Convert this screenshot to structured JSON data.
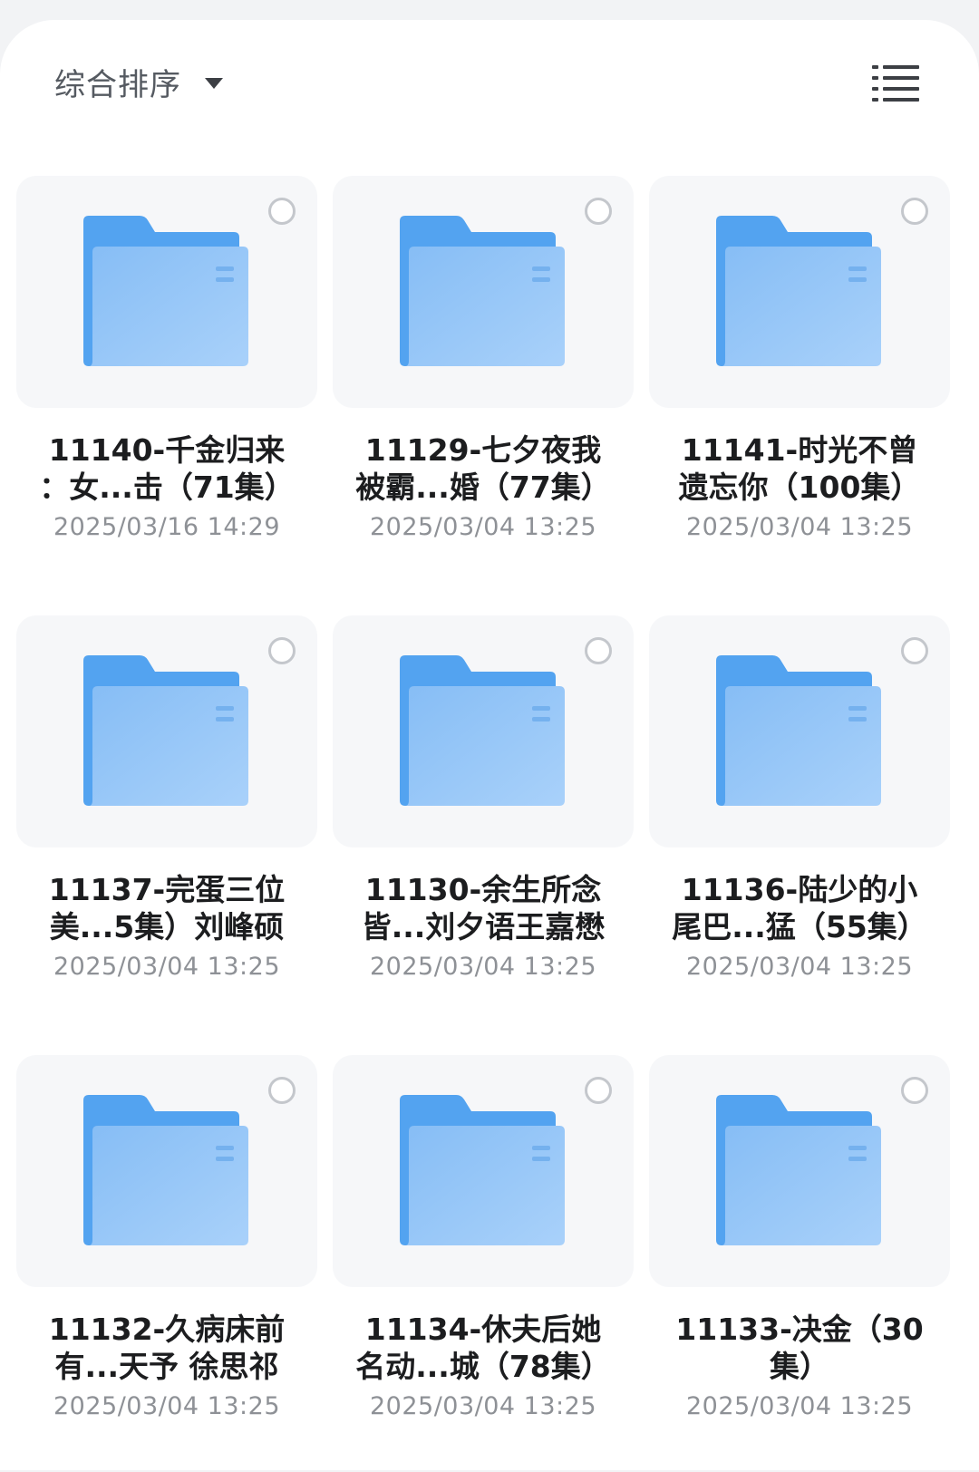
{
  "header": {
    "sort_label": "综合排序",
    "sort_icon": "caret-down-icon",
    "view_toggle_icon": "list-view-icon"
  },
  "colors": {
    "folder_back": "#4f9ff0",
    "folder_front": "#8fc3f7",
    "background": "#ffffff"
  },
  "files": [
    {
      "name": "11140-千金归来\n：女...击（71集）",
      "date": "2025/03/16 14:29"
    },
    {
      "name": "11129-七夕夜我\n被霸...婚（77集）",
      "date": "2025/03/04 13:25"
    },
    {
      "name": "11141-时光不曾\n遗忘你（100集）",
      "date": "2025/03/04 13:25"
    },
    {
      "name": "11137-完蛋三位\n美...5集）刘峰硕",
      "date": "2025/03/04 13:25"
    },
    {
      "name": "11130-余生所念\n皆...刘夕语王嘉懋",
      "date": "2025/03/04 13:25"
    },
    {
      "name": "11136-陆少的小\n尾巴...猛（55集）",
      "date": "2025/03/04 13:25"
    },
    {
      "name": "11132-久病床前\n有...天予 徐思祁",
      "date": "2025/03/04 13:25"
    },
    {
      "name": "11134-休夫后她\n名动...城（78集）",
      "date": "2025/03/04 13:25"
    },
    {
      "name": "11133-决金（30\n集）",
      "date": "2025/03/04 13:25"
    }
  ]
}
